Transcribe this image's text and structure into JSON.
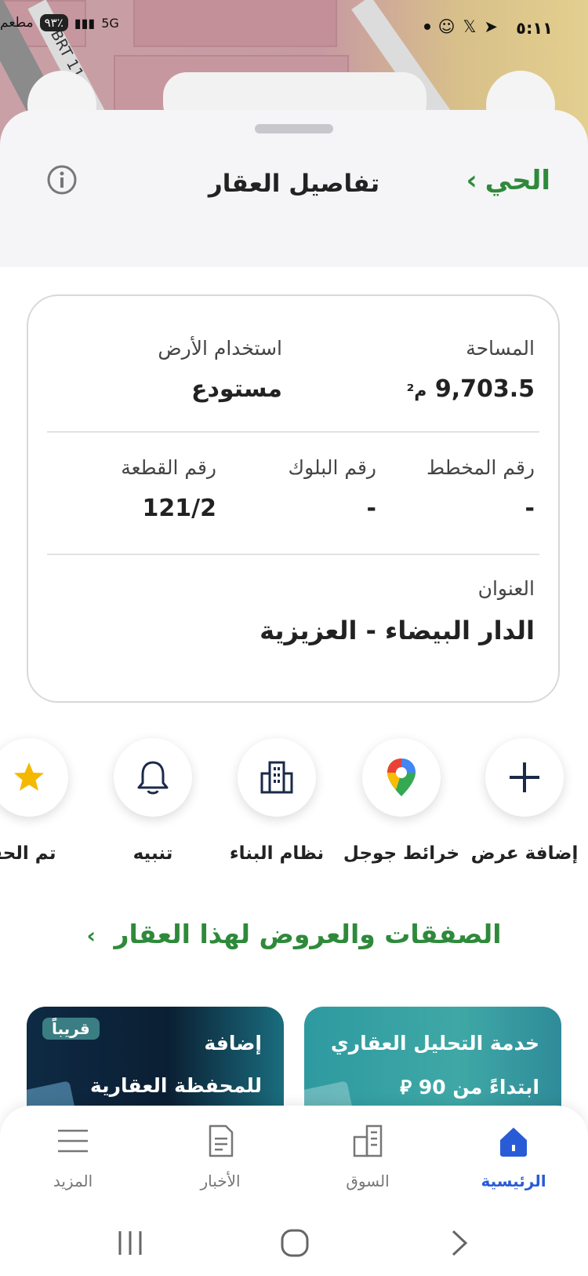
{
  "status_bar": {
    "time": "٥:١١",
    "carrier": "مطعم",
    "battery_pill": "٩٣٪",
    "network": "5G"
  },
  "map": {
    "road_label": "BRT 11"
  },
  "header": {
    "title": "تفاصيل العقار",
    "back_label": "الحي"
  },
  "property": {
    "area_label": "المساحة",
    "area_value": "9,703.5",
    "area_unit": "م²",
    "land_use_label": "استخدام الأرض",
    "land_use_value": "مستودع",
    "plan_label": "رقم المخطط",
    "plan_value": "-",
    "block_label": "رقم البلوك",
    "block_value": "-",
    "plot_label": "رقم القطعة",
    "plot_value": "121/2",
    "address_label": "العنوان",
    "address_value": "الدار البيضاء - العزيزية"
  },
  "actions": [
    {
      "label": "إضافة عرض",
      "icon": "plus-icon"
    },
    {
      "label": "خرائط جوجل",
      "icon": "google-maps-pin-icon"
    },
    {
      "label": "نظام البناء",
      "icon": "building-icon"
    },
    {
      "label": "تنبيه",
      "icon": "bell-icon"
    },
    {
      "label": "تم الحفظ",
      "icon": "star-icon"
    }
  ],
  "deals_link": "الصفقات والعروض لهذا العقار",
  "promos": [
    {
      "title": "خدمة التحليل العقاري",
      "subtitle": "ابتداءً من 90"
    },
    {
      "title": "إضافة",
      "subtitle": "للمحفظة العقارية",
      "badge": "قريباً"
    }
  ],
  "bottom_nav": [
    {
      "label": "الرئيسية",
      "icon": "home-icon",
      "active": true
    },
    {
      "label": "السوق",
      "icon": "market-icon",
      "active": false
    },
    {
      "label": "الأخبار",
      "icon": "news-icon",
      "active": false
    },
    {
      "label": "المزيد",
      "icon": "menu-icon",
      "active": false
    }
  ],
  "colors": {
    "accent_green": "#2e8a3a",
    "active_blue": "#2a5bd7",
    "promo_teal": "#3fa8a6",
    "promo_navy": "#0b1f33"
  }
}
